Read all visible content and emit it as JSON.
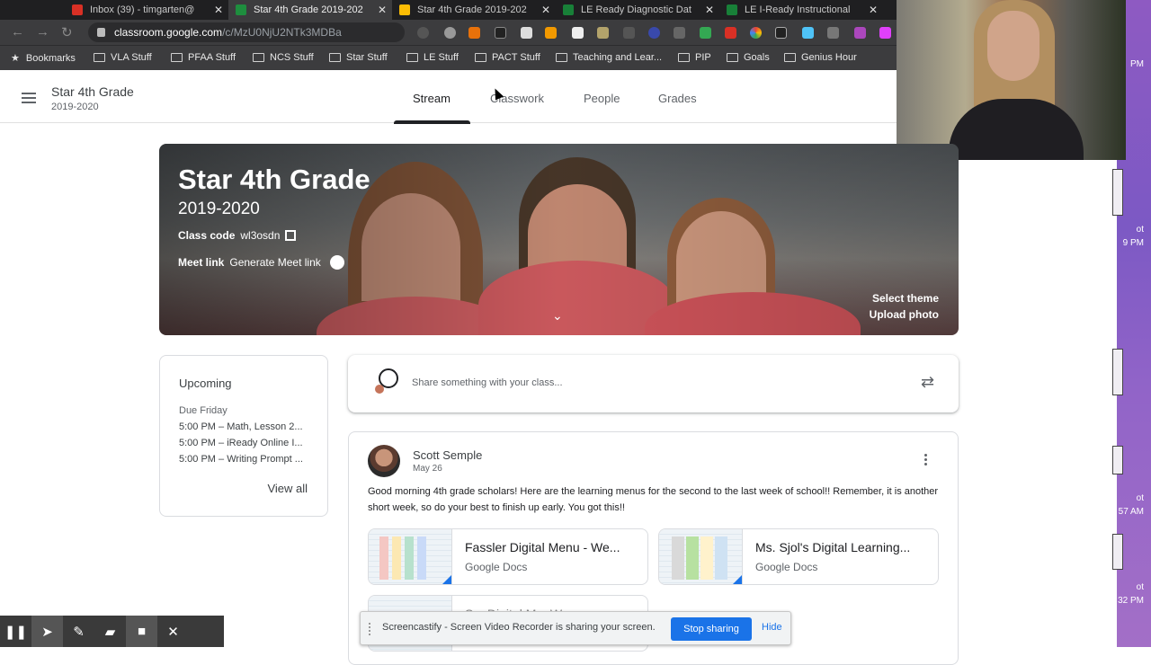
{
  "browser": {
    "tabs": [
      {
        "title": "Inbox (39) - timgarten@",
        "active": false,
        "favicon_color": "#d93025"
      },
      {
        "title": "Star 4th Grade 2019-202",
        "active": true,
        "favicon_color": "#1e8e3e"
      },
      {
        "title": "Star 4th Grade 2019-202",
        "active": false,
        "favicon_color": "#fbbc04"
      },
      {
        "title": "LE Ready Diagnostic Dat",
        "active": false,
        "favicon_color": "#188038"
      },
      {
        "title": "LE I-Ready Instructional",
        "active": false,
        "favicon_color": "#188038"
      }
    ],
    "url_host": "classroom.google.com",
    "url_path": "/c/MzU0NjU2NTk3MDBa",
    "bookmarks": [
      "Bookmarks",
      "VLA Stuff",
      "PFAA Stuff",
      "NCS Stuff",
      "Star Stuff",
      "LE Stuff",
      "PACT Stuff",
      "Teaching and Lear...",
      "PIP",
      "Goals",
      "Genius Hour"
    ]
  },
  "header": {
    "class_name": "Star 4th Grade",
    "class_year": "2019-2020",
    "tabs": [
      "Stream",
      "Classwork",
      "People",
      "Grades"
    ]
  },
  "banner": {
    "title": "Star 4th Grade",
    "year": "2019-2020",
    "class_code_label": "Class code",
    "class_code": "wl3osdn",
    "meet_label": "Meet link",
    "meet_action": "Generate Meet link",
    "select_theme": "Select theme",
    "upload_photo": "Upload photo"
  },
  "upcoming": {
    "title": "Upcoming",
    "due": "Due Friday",
    "items": [
      "5:00 PM – Math, Lesson 2...",
      "5:00 PM – iReady Online I...",
      "5:00 PM – Writing Prompt ..."
    ],
    "view_all": "View all"
  },
  "share": {
    "placeholder": "Share something with your class..."
  },
  "post": {
    "author": "Scott Semple",
    "date": "May 26",
    "body": "Good morning 4th grade scholars! Here are the learning menus for the second to the last week of school!! Remember, it is another short week, so do your best to finish up early. You got this!!",
    "attachments": [
      {
        "title": "Fassler Digital Menu - We...",
        "type": "Google Docs"
      },
      {
        "title": "Ms. Sjol's Digital Learning...",
        "type": "Google Docs"
      },
      {
        "title": "S... Digital M... W...",
        "type": "Google Docs"
      }
    ]
  },
  "right_strip": [
    "PM",
    "ot",
    "9 PM",
    "ot",
    "57 AM",
    "ot",
    "32 PM"
  ],
  "screencastify": {
    "message": "Screencastify - Screen Video Recorder is sharing your screen.",
    "stop": "Stop sharing",
    "hide": "Hide"
  }
}
